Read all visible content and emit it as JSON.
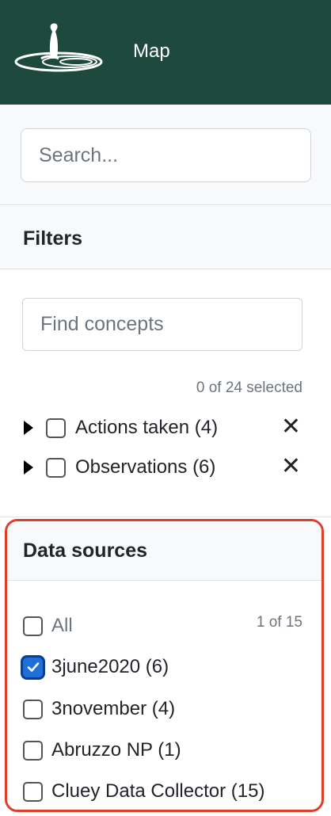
{
  "header": {
    "title": "Map",
    "logo_icon": "meerkat-logo-icon",
    "background": "#1d4a3c"
  },
  "search": {
    "placeholder": "Search..."
  },
  "filters": {
    "title": "Filters",
    "concepts_placeholder": "Find concepts",
    "selected_count": "0 of 24 selected",
    "items": [
      {
        "label": "Actions taken (4)",
        "checked": false
      },
      {
        "label": "Observations (6)",
        "checked": false
      }
    ]
  },
  "data_sources": {
    "title": "Data sources",
    "count": "1 of 15",
    "highlight_color": "#e0402a",
    "items": [
      {
        "label": "All",
        "checked": false
      },
      {
        "label": "3june2020 (6)",
        "checked": true
      },
      {
        "label": "3november (4)",
        "checked": false
      },
      {
        "label": "Abruzzo NP (1)",
        "checked": false
      },
      {
        "label": "Cluey Data Collector (15)",
        "checked": false
      }
    ]
  }
}
